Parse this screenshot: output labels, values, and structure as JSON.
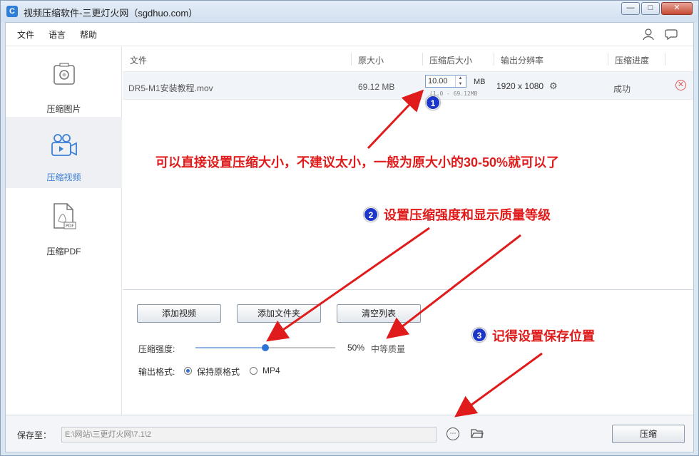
{
  "window": {
    "title": "视频压缩软件-三更灯火网（sgdhuo.com）",
    "app_icon_letter": "C"
  },
  "menu": {
    "file": "文件",
    "language": "语言",
    "help": "帮助"
  },
  "sidebar": {
    "items": [
      {
        "label": "压缩图片",
        "icon": "image-icon",
        "active": false
      },
      {
        "label": "压缩视频",
        "icon": "video-camera-icon",
        "active": true
      },
      {
        "label": "压缩PDF",
        "icon": "pdf-icon",
        "active": false
      }
    ]
  },
  "table": {
    "headers": {
      "file": "文件",
      "original_size": "原大小",
      "compressed_size": "压缩后大小",
      "resolution": "输出分辨率",
      "progress": "压缩进度"
    },
    "rows": [
      {
        "file": "DR5-M1安装教程.mov",
        "original_size": "69.12 MB",
        "compressed_value": "10.00",
        "unit": "MB",
        "range": "(1.0 - 69.12MB",
        "resolution": "1920 x 1080",
        "status": "成功"
      }
    ]
  },
  "controls": {
    "add_video": "添加视频",
    "add_folder": "添加文件夹",
    "clear_list": "清空列表",
    "strength_label": "压缩强度:",
    "strength_value": "50%",
    "strength_percent": 50,
    "quality_label": "中等质量",
    "format_label": "输出格式:",
    "format_keep": "保持原格式",
    "format_mp4": "MP4"
  },
  "footer": {
    "save_label": "保存至：",
    "path": "E:\\网站\\三更灯火网\\7.1\\2",
    "compress_button": "压缩"
  },
  "annotations": {
    "badge1": "1",
    "badge2": "2",
    "badge3": "3",
    "note1": "可以直接设置压缩大小，不建议太小，一般为原大小的30-50%就可以了",
    "note2": "设置压缩强度和显示质量等级",
    "note3": "记得设置保存位置",
    "color": "#e01b1b"
  }
}
